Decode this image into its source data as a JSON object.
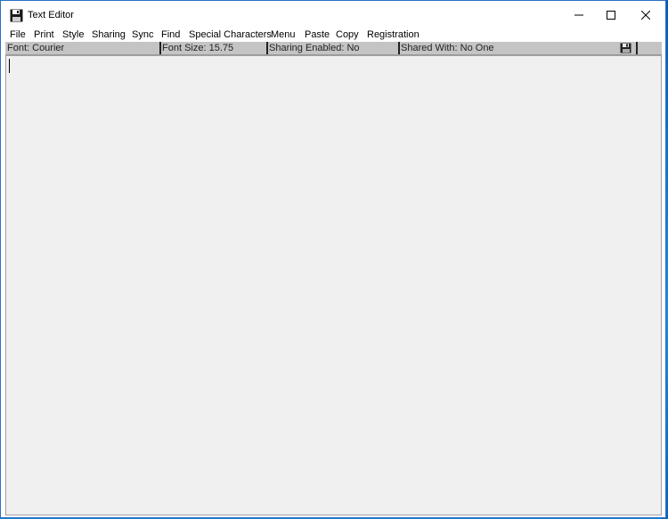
{
  "window": {
    "title": "Text Editor",
    "controls": {
      "minimize": "minimize-icon",
      "maximize": "maximize-icon",
      "close": "close-icon"
    }
  },
  "menu": {
    "items": [
      {
        "label": "File"
      },
      {
        "label": "Print"
      },
      {
        "label": "Style"
      },
      {
        "label": "Sharing"
      },
      {
        "label": "Sync"
      },
      {
        "label": "Find"
      },
      {
        "label": "Special Characters"
      },
      {
        "label": "Menu"
      },
      {
        "label": "Paste"
      },
      {
        "label": "Copy"
      },
      {
        "label": "Registration"
      }
    ]
  },
  "status": {
    "font": "Font:  Courier",
    "font_size": "Font Size: 15.75",
    "sharing_enabled": "Sharing Enabled:  No",
    "shared_with": "Shared With:   No One",
    "save_icon": "save-icon"
  },
  "editor": {
    "content": ""
  },
  "colors": {
    "desktop": "#1a7fd6",
    "status_bg": "#c4c4c4",
    "editor_bg": "#f0f0f0"
  }
}
